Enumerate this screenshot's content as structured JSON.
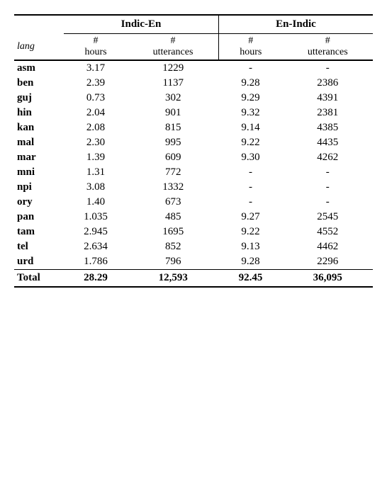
{
  "table": {
    "group_headers": [
      {
        "label": "",
        "colspan": 1
      },
      {
        "label": "Indic-En",
        "colspan": 2
      },
      {
        "label": "En-Indic",
        "colspan": 2
      }
    ],
    "sub_headers": [
      "lang",
      "#\nhours",
      "#\nutterances",
      "#\nhours",
      "#\nutterances"
    ],
    "rows": [
      {
        "lang": "asm",
        "indic_en_hours": "3.17",
        "indic_en_utt": "1229",
        "en_indic_hours": "-",
        "en_indic_utt": "-"
      },
      {
        "lang": "ben",
        "indic_en_hours": "2.39",
        "indic_en_utt": "1137",
        "en_indic_hours": "9.28",
        "en_indic_utt": "2386"
      },
      {
        "lang": "guj",
        "indic_en_hours": "0.73",
        "indic_en_utt": "302",
        "en_indic_hours": "9.29",
        "en_indic_utt": "4391"
      },
      {
        "lang": "hin",
        "indic_en_hours": "2.04",
        "indic_en_utt": "901",
        "en_indic_hours": "9.32",
        "en_indic_utt": "2381"
      },
      {
        "lang": "kan",
        "indic_en_hours": "2.08",
        "indic_en_utt": "815",
        "en_indic_hours": "9.14",
        "en_indic_utt": "4385"
      },
      {
        "lang": "mal",
        "indic_en_hours": "2.30",
        "indic_en_utt": "995",
        "en_indic_hours": "9.22",
        "en_indic_utt": "4435"
      },
      {
        "lang": "mar",
        "indic_en_hours": "1.39",
        "indic_en_utt": "609",
        "en_indic_hours": "9.30",
        "en_indic_utt": "4262"
      },
      {
        "lang": "mni",
        "indic_en_hours": "1.31",
        "indic_en_utt": "772",
        "en_indic_hours": "-",
        "en_indic_utt": "-"
      },
      {
        "lang": "npi",
        "indic_en_hours": "3.08",
        "indic_en_utt": "1332",
        "en_indic_hours": "-",
        "en_indic_utt": "-"
      },
      {
        "lang": "ory",
        "indic_en_hours": "1.40",
        "indic_en_utt": "673",
        "en_indic_hours": "-",
        "en_indic_utt": "-"
      },
      {
        "lang": "pan",
        "indic_en_hours": "1.035",
        "indic_en_utt": "485",
        "en_indic_hours": "9.27",
        "en_indic_utt": "2545"
      },
      {
        "lang": "tam",
        "indic_en_hours": "2.945",
        "indic_en_utt": "1695",
        "en_indic_hours": "9.22",
        "en_indic_utt": "4552"
      },
      {
        "lang": "tel",
        "indic_en_hours": "2.634",
        "indic_en_utt": "852",
        "en_indic_hours": "9.13",
        "en_indic_utt": "4462"
      },
      {
        "lang": "urd",
        "indic_en_hours": "1.786",
        "indic_en_utt": "796",
        "en_indic_hours": "9.28",
        "en_indic_utt": "2296"
      }
    ],
    "footer": {
      "lang": "Total",
      "indic_en_hours": "28.29",
      "indic_en_utt": "12,593",
      "en_indic_hours": "92.45",
      "en_indic_utt": "36,095"
    }
  }
}
